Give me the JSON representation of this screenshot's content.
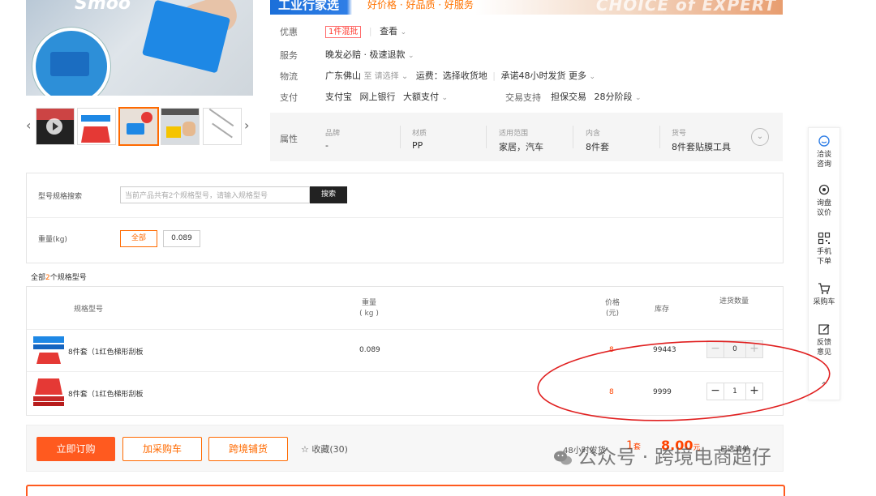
{
  "banner": {
    "title": "工业行家选",
    "slogan": "好价格 · 好品质 · 好服务",
    "english": "CHOICE of EXPERT"
  },
  "main_image": {
    "brand_text": "Smoo"
  },
  "info": {
    "discount_label": "优惠",
    "discount_tag": "1件混批",
    "discount_view": "查看",
    "service_label": "服务",
    "service_value": "晚发必赔 · 极速退款",
    "logistics_label": "物流",
    "logistics_origin": "广东佛山",
    "logistics_to": "至 请选择",
    "logistics_fee": "运费：选择收货地",
    "logistics_promise": "承诺48小时发货",
    "logistics_more": "更多",
    "payment_label": "支付",
    "payment_methods": [
      "支付宝",
      "网上银行",
      "大额支付"
    ],
    "trade_label": "交易支持",
    "trade_values": [
      "担保交易",
      "28分阶段"
    ]
  },
  "attributes": {
    "title": "属性",
    "items": [
      {
        "key": "品牌",
        "value": "-"
      },
      {
        "key": "材质",
        "value": "PP"
      },
      {
        "key": "适用范围",
        "value": "家居，汽车"
      },
      {
        "key": "内含",
        "value": "8件套"
      },
      {
        "key": "货号",
        "value": "8件套贴膜工具"
      }
    ]
  },
  "filter": {
    "search_label": "型号规格搜索",
    "search_placeholder": "当前产品共有2个规格型号，请输入规格型号",
    "search_button": "搜索",
    "weight_label": "重量(kg)",
    "weight_options": [
      "全部",
      "0.089"
    ]
  },
  "spec_count": {
    "prefix": "全部",
    "count": "2",
    "suffix": "个规格型号"
  },
  "table": {
    "headers": {
      "spec": "规格型号",
      "weight_line1": "重量",
      "weight_line2": "( kg )",
      "price_line1": "价格",
      "price_line2": "(元)",
      "stock": "库存",
      "qty": "进货数量"
    },
    "rows": [
      {
        "name": "8件套（1红色梯形刮板",
        "weight": "0.089",
        "price": "8",
        "stock": "99443",
        "qty": "0"
      },
      {
        "name": "8件套（1红色梯形刮板",
        "weight": "",
        "price": "8",
        "stock": "9999",
        "qty": "1"
      }
    ]
  },
  "actions": {
    "order_now": "立即订购",
    "add_cart": "加采购车",
    "cross_border": "跨境铺货",
    "favorite": "收藏(30)",
    "ship": "48小时发货",
    "qty_total": "1",
    "qty_unit": "套",
    "price_total": "8.00",
    "price_unit": "元",
    "selected_list": "已选清单"
  },
  "sidebar": {
    "items": [
      {
        "label": "洽谈咨询"
      },
      {
        "label": "询盘议价"
      },
      {
        "label": "手机下单"
      },
      {
        "label": "采购车"
      },
      {
        "label": "反馈意见"
      }
    ]
  },
  "watermark": {
    "text": "公众号 · 跨境电商超仔"
  },
  "colors": {
    "accent": "#ff5a1f",
    "price": "#ff4400",
    "annotation": "#e02020"
  }
}
